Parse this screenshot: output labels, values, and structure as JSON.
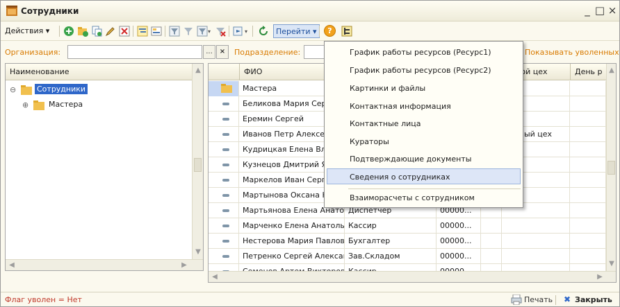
{
  "window": {
    "title": "Сотрудники",
    "buttons": [
      "_",
      "□",
      "×"
    ]
  },
  "toolbar": {
    "actions_label": "Действия ▾",
    "goto_label": "Перейти ▾",
    "help_icon": "?"
  },
  "filters": {
    "org_label": "Организация:",
    "org_value": "",
    "org_select": "...",
    "org_clear": "×",
    "dept_label": "Подразделение:",
    "show_dismissed_label": "Показывать уволенных"
  },
  "tree": {
    "header": "Наименование",
    "items": [
      {
        "label": "Сотрудники",
        "expander": "⊖",
        "selected": true
      },
      {
        "label": "Мастера",
        "expander": "⊕",
        "selected": false
      }
    ]
  },
  "grid": {
    "columns": [
      "ФИО",
      "",
      "",
      "",
      "овной цех",
      "День р"
    ],
    "rows": [
      {
        "name": "Мастера",
        "position": "",
        "code": "",
        "extra": "",
        "folder": true
      },
      {
        "name": "Беликова Мария Сер",
        "position": "",
        "code": "",
        "extra": ""
      },
      {
        "name": "Еремин Сергей",
        "position": "",
        "code": "",
        "extra": ""
      },
      {
        "name": "Иванов Петр Алексе",
        "position": "",
        "code": "",
        "extra": "сарный цех"
      },
      {
        "name": "Кудрицкая Елена Вла",
        "position": "",
        "code": "",
        "extra": ""
      },
      {
        "name": "Кузнецов Дмитрий Я",
        "position": "",
        "code": "",
        "extra": ""
      },
      {
        "name": "Маркелов Иван Серг",
        "position": "",
        "code": "",
        "extra": ""
      },
      {
        "name": "Мартынова Оксана Н",
        "position": "",
        "code": "",
        "extra": ""
      },
      {
        "name": "Мартьянова Елена Анатоль...",
        "position": "Диспетчер",
        "code": "00000...",
        "extra": ""
      },
      {
        "name": "Марченко Елена Анатольевна",
        "position": "Кассир",
        "code": "00000...",
        "extra": ""
      },
      {
        "name": "Нестерова Мария Павловна",
        "position": "Бухгалтер",
        "code": "00000...",
        "extra": ""
      },
      {
        "name": "Петренко Сергей Александ...",
        "position": "Зав.Складом",
        "code": "00000...",
        "extra": ""
      },
      {
        "name": "Семенов Артем Викторович",
        "position": "Кассир",
        "code": "00000...",
        "extra": ""
      }
    ]
  },
  "goto_menu": {
    "items": [
      "График работы ресурсов (Ресурс1)",
      "График работы ресурсов (Ресурс2)",
      "Картинки и файлы",
      "Контактная информация",
      "Контактные лица",
      "Кураторы",
      "Подтверждающие документы",
      "Сведения о сотрудниках",
      "Взаиморасчеты с сотрудником"
    ],
    "highlighted_index": 7
  },
  "status": {
    "flag_text": "Флаг уволен = Нет",
    "print_label": "Печать",
    "close_label": "Закрыть"
  },
  "colors": {
    "accent_orange": "#d87a00",
    "status_red": "#c0392b",
    "highlight": "#dde6f7",
    "selection": "#2f67c9"
  }
}
